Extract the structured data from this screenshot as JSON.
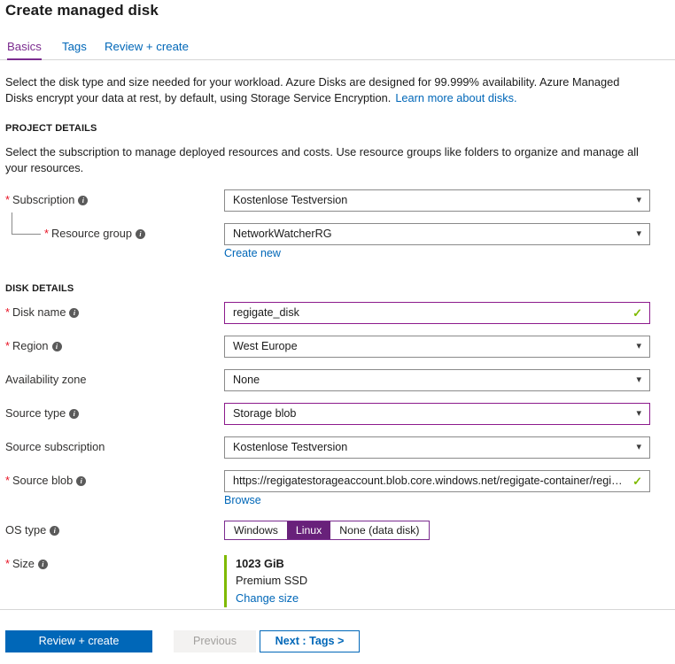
{
  "page_title": "Create managed disk",
  "tabs": [
    {
      "label": "Basics",
      "active": true
    },
    {
      "label": "Tags",
      "active": false
    },
    {
      "label": "Review + create",
      "active": false
    }
  ],
  "description": {
    "text": "Select the disk type and size needed for your workload. Azure Disks are designed for 99.999% availability. Azure Managed Disks encrypt your data at rest, by default, using Storage Service Encryption.",
    "link": "Learn more about disks."
  },
  "project_details": {
    "heading": "PROJECT DETAILS",
    "description": "Select the subscription to manage deployed resources and costs. Use resource groups like folders to organize and manage all your resources.",
    "subscription": {
      "label": "Subscription",
      "required": "*",
      "value": "Kostenlose Testversion"
    },
    "resource_group": {
      "label": "Resource group",
      "required": "*",
      "value": "NetworkWatcherRG",
      "create_new_link": "Create new"
    }
  },
  "disk_details": {
    "heading": "DISK DETAILS",
    "disk_name": {
      "label": "Disk name",
      "required": "*",
      "value": "regigate_disk"
    },
    "region": {
      "label": "Region",
      "required": "*",
      "value": "West Europe"
    },
    "availability_zone": {
      "label": "Availability zone",
      "value": "None"
    },
    "source_type": {
      "label": "Source type",
      "value": "Storage blob"
    },
    "source_subscription": {
      "label": "Source subscription",
      "value": "Kostenlose Testversion"
    },
    "source_blob": {
      "label": "Source blob",
      "required": "*",
      "value": "https://regigatestorageaccount.blob.core.windows.net/regigate-container/regigate...",
      "browse_link": "Browse"
    },
    "os_type": {
      "label": "OS type",
      "options": [
        {
          "label": "Windows",
          "selected": false
        },
        {
          "label": "Linux",
          "selected": true
        },
        {
          "label": "None (data disk)",
          "selected": false
        }
      ]
    },
    "size": {
      "label": "Size",
      "required": "*",
      "value": "1023 GiB",
      "tier": "Premium SSD",
      "change_link": "Change size"
    }
  },
  "footer": {
    "review_create": "Review + create",
    "previous": "Previous",
    "next": "Next : Tags >"
  },
  "icons": {
    "info": "i",
    "chevron_down": "⌄",
    "check": "✓"
  },
  "colors": {
    "accent_purple": "#7b2c8f",
    "selected_purple": "#68217a",
    "link_blue": "#0067b8",
    "required_red": "#e81123",
    "valid_green": "#7fba00"
  }
}
